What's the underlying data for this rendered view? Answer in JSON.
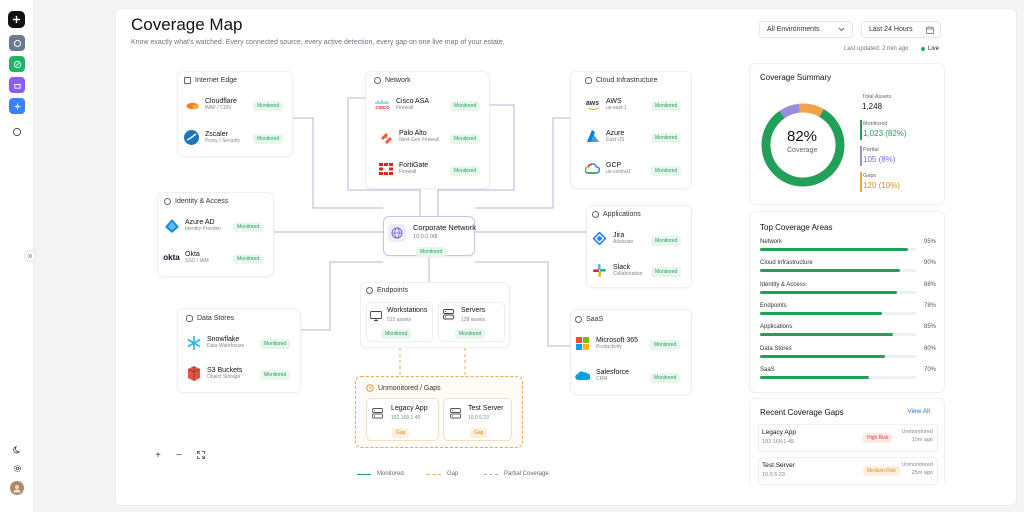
{
  "header": {
    "title": "Coverage Map",
    "subtitle": "Know exactly what's watched. Every connected source, every active detection, every gap on one live map of your estate.",
    "env_select": "All Environments",
    "time_select": "Last 24 Hours",
    "last_updated": "Last updated: 2 min ago",
    "live": "Live"
  },
  "status": {
    "monitored": "Monitored",
    "gap": "Gap"
  },
  "groups": {
    "internet_edge": {
      "title": "Internet Edge",
      "nodes": [
        {
          "name": "Cloudflare",
          "sub": "WAF / CDN"
        },
        {
          "name": "Zscaler",
          "sub": "Proxy / Security"
        }
      ]
    },
    "network": {
      "title": "Network",
      "nodes": [
        {
          "name": "Cisco ASA",
          "sub": "Firewall",
          "logo_text": "CISCO"
        },
        {
          "name": "Palo Alto",
          "sub": "Next-Gen Firewall"
        },
        {
          "name": "FortiGate",
          "sub": "Firewall"
        }
      ]
    },
    "cloud": {
      "title": "Cloud Infrastructure",
      "nodes": [
        {
          "name": "AWS",
          "sub": "us-east-1",
          "logo_text": "aws"
        },
        {
          "name": "Azure",
          "sub": "East US"
        },
        {
          "name": "GCP",
          "sub": "us-central1"
        }
      ]
    },
    "identity": {
      "title": "Identity & Access",
      "nodes": [
        {
          "name": "Azure AD",
          "sub": "Identity Provider"
        },
        {
          "name": "Okta",
          "sub": "SSO / IAM",
          "logo_text": "okta"
        }
      ]
    },
    "applications": {
      "title": "Applications",
      "nodes": [
        {
          "name": "Jira",
          "sub": "Atlassian"
        },
        {
          "name": "Slack",
          "sub": "Collaboration"
        }
      ]
    },
    "endpoints": {
      "title": "Endpoints",
      "nodes": [
        {
          "name": "Workstations",
          "sub": "512 assets"
        },
        {
          "name": "Servers",
          "sub": "128 assets"
        }
      ]
    },
    "data_stores": {
      "title": "Data Stores",
      "nodes": [
        {
          "name": "Snowflake",
          "sub": "Data Warehouse"
        },
        {
          "name": "S3 Buckets",
          "sub": "Object Storage"
        }
      ]
    },
    "saas": {
      "title": "SaaS",
      "nodes": [
        {
          "name": "Microsoft 365",
          "sub": "Productivity"
        },
        {
          "name": "Salesforce",
          "sub": "CRM"
        }
      ]
    },
    "unmonitored": {
      "title": "Unmonitored / Gaps",
      "nodes": [
        {
          "name": "Legacy App",
          "sub": "192.168.1.45"
        },
        {
          "name": "Test Server",
          "sub": "10.0.5.23"
        }
      ]
    }
  },
  "center": {
    "name": "Corporate Network",
    "cidr": "10.0.0.0/8"
  },
  "legend": {
    "monitored": "Monitored",
    "gap": "Gap",
    "partial": "Partial Coverage"
  },
  "summary": {
    "title": "Coverage Summary",
    "percent": "82%",
    "center_label": "Coverage",
    "total_label": "Total Assets",
    "total_value": "1,248",
    "monitored_label": "Monitored",
    "monitored_value": "1,023 (82%)",
    "partial_label": "Partial",
    "partial_value": "105 (8%)",
    "gaps_label": "Gaps",
    "gaps_value": "120 (10%)",
    "colors": {
      "monitored": "#22a05a",
      "partial": "#9b8ce0",
      "gaps": "#f0a44a"
    }
  },
  "top_areas": {
    "title": "Top Coverage Areas",
    "items": [
      {
        "name": "Network",
        "pct": "95%",
        "value": 95
      },
      {
        "name": "Cloud Infrastructure",
        "pct": "90%",
        "value": 90
      },
      {
        "name": "Identity & Access",
        "pct": "88%",
        "value": 88
      },
      {
        "name": "Endpoints",
        "pct": "78%",
        "value": 78
      },
      {
        "name": "Applications",
        "pct": "85%",
        "value": 85
      },
      {
        "name": "Data Stores",
        "pct": "80%",
        "value": 80
      },
      {
        "name": "SaaS",
        "pct": "70%",
        "value": 70
      }
    ]
  },
  "recent_gaps": {
    "title": "Recent Coverage Gaps",
    "view_all": "View All",
    "items": [
      {
        "name": "Legacy App",
        "ip": "192.168.1.45",
        "risk": "High Risk",
        "status": "Unmonitored",
        "time": "10m ago"
      },
      {
        "name": "Test Server",
        "ip": "10.0.5.23",
        "risk": "Medium Risk",
        "status": "Unmonitored",
        "time": "25m ago"
      }
    ]
  }
}
